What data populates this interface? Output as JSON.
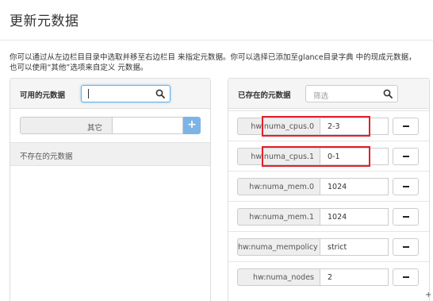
{
  "header": {
    "title": "更新元数据"
  },
  "description": {
    "line1": "你可以通过从左边栏目目录中选取并移至右边栏目 来指定元数据。你可以选择已添加至glance目录字典 中的现成元数据，",
    "line2": "也可以使用“其他”选项来自定义 元数据。"
  },
  "available": {
    "title": "可用的元数据",
    "search_value": "",
    "custom_label": "其它",
    "add_icon": "plus-icon",
    "empty_text": "不存在的元数据"
  },
  "existing": {
    "title": "已存在的元数据",
    "search_placeholder": "筛选",
    "rows": [
      {
        "key": "hw:numa_cpus.0",
        "value": "2-3",
        "highlighted": true
      },
      {
        "key": "hw:numa_cpus.1",
        "value": "0-1",
        "highlighted": true
      },
      {
        "key": "hw:numa_mem.0",
        "value": "1024",
        "highlighted": false
      },
      {
        "key": "hw:numa_mem.1",
        "value": "1024",
        "highlighted": false
      },
      {
        "key": "hw:numa_mempolicy",
        "value": "strict",
        "highlighted": false
      },
      {
        "key": "hw:numa_nodes",
        "value": "2",
        "highlighted": false
      }
    ]
  },
  "colors": {
    "highlight": "#e3202b",
    "add_button": "#7db4e6",
    "focus_border": "#66afe9"
  },
  "icons": {
    "search": "search-icon",
    "remove": "minus-icon",
    "add": "plus-icon"
  }
}
